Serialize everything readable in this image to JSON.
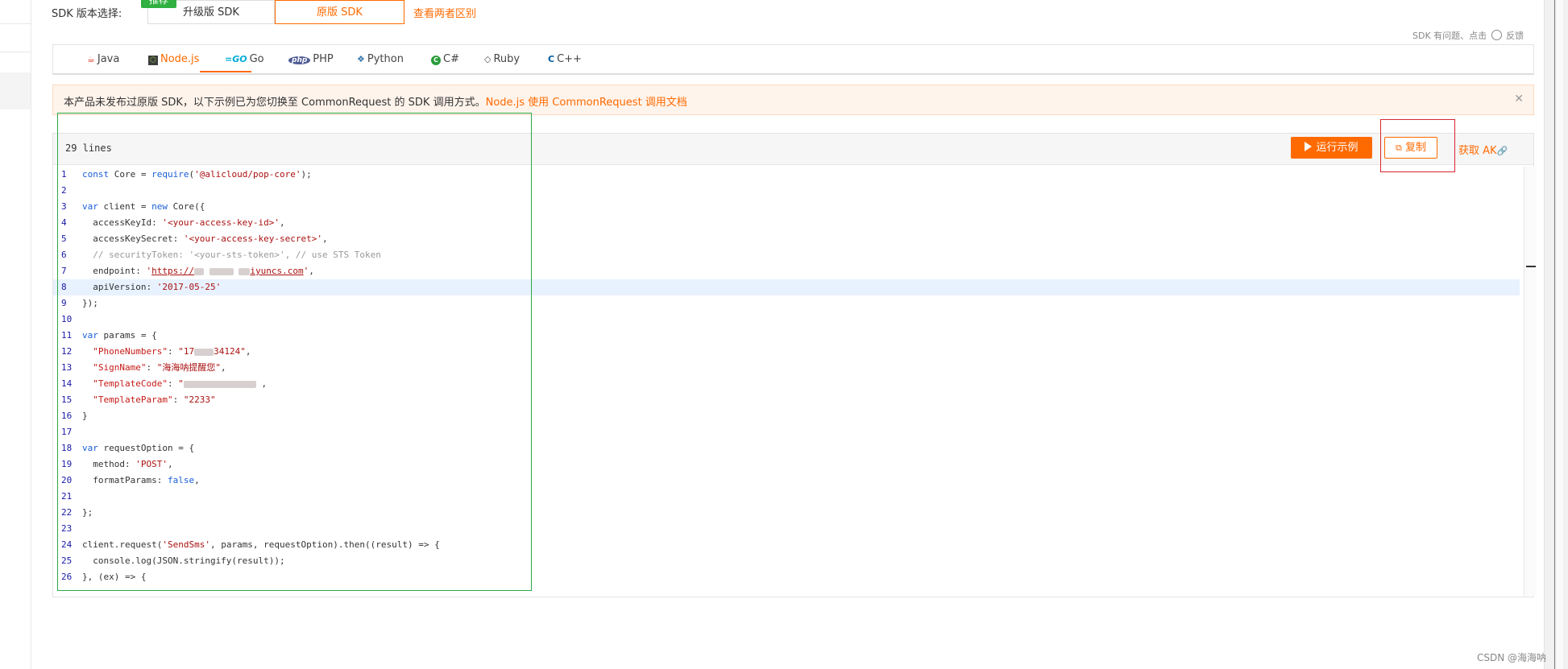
{
  "sdk_selector": {
    "label": "SDK 版本选择:",
    "badge": "推荐",
    "upgrade_label": "升级版 SDK",
    "original_label": "原版 SDK",
    "diff_link": "查看两者区别"
  },
  "feedback": {
    "prefix": "SDK 有问题、点击",
    "suffix": "反馈"
  },
  "tabs": [
    {
      "label": "Java",
      "icon": "java-icon"
    },
    {
      "label": "Node.js",
      "icon": "nodejs-icon",
      "active": true
    },
    {
      "label": "Go",
      "icon": "go-icon"
    },
    {
      "label": "PHP",
      "icon": "php-icon"
    },
    {
      "label": "Python",
      "icon": "python-icon"
    },
    {
      "label": "C#",
      "icon": "csharp-icon"
    },
    {
      "label": "Ruby",
      "icon": "ruby-icon"
    },
    {
      "label": "C++",
      "icon": "cpp-icon"
    }
  ],
  "notice": {
    "text": "本产品未发布过原版 SDK，以下示例已为您切换至 CommonRequest 的 SDK 调用方式。",
    "link": "Node.js 使用 CommonRequest 调用文档"
  },
  "code_panel": {
    "lines_count": "29 lines",
    "run_label": "运行示例",
    "copy_label": "复制",
    "ak_label": "获取 AK"
  },
  "code": {
    "l1_kw": "const",
    "l1_a": " Core = ",
    "l1_req": "require",
    "l1_b": "(",
    "l1_str": "'@alicloud/pop-core'",
    "l1_c": ");",
    "l3_kw": "var",
    "l3_a": " client = ",
    "l3_new": "new",
    "l3_b": " Core({",
    "l4_a": "  accessKeyId: ",
    "l4_str": "'<your-access-key-id>'",
    "l4_b": ",",
    "l5_a": "  accessKeySecret: ",
    "l5_str": "'<your-access-key-secret>'",
    "l5_b": ",",
    "l6_cmt": "  // securityToken: '<your-sts-token>', // use STS Token",
    "l7_a": "  endpoint: ",
    "l7_q1": "'",
    "l7_url_a": "https://",
    "l7_url_b": "iyuncs.com",
    "l7_q2": "'",
    "l7_b": ",",
    "l8_a": "  apiVersion: ",
    "l8_str": "'2017-05-25'",
    "l9": "});",
    "l11_kw": "var",
    "l11_a": " params = {",
    "l12_key": "  \"PhoneNumbers\"",
    "l12_a": ": ",
    "l12_s1": "\"17",
    "l12_s2": "34124\"",
    "l12_b": ",",
    "l13_key": "  \"SignName\"",
    "l13_a": ": ",
    "l13_str": "\"海海呐提醒您\"",
    "l13_b": ",",
    "l14_key": "  \"TemplateCode\"",
    "l14_a": ": ",
    "l14_s1": "\"",
    "l14_b": ",",
    "l15_key": "  \"TemplateParam\"",
    "l15_a": ": ",
    "l15_str": "\"2233\"",
    "l16": "}",
    "l18_kw": "var",
    "l18_a": " requestOption = {",
    "l19_a": "  method: ",
    "l19_str": "'POST'",
    "l19_b": ",",
    "l20_a": "  formatParams: ",
    "l20_kw": "false",
    "l20_b": ",",
    "l22": "};",
    "l24_a": "client.request(",
    "l24_str": "'SendSms'",
    "l24_b": ", params, requestOption).then((result) => {",
    "l25": "  console.log(JSON.stringify(result));",
    "l26": "}, (ex) => {"
  },
  "line_numbers": [
    "1",
    "2",
    "3",
    "4",
    "5",
    "6",
    "7",
    "8",
    "9",
    "10",
    "11",
    "12",
    "13",
    "14",
    "15",
    "16",
    "17",
    "18",
    "19",
    "20",
    "21",
    "22",
    "23",
    "24",
    "25",
    "26"
  ],
  "watermark": "CSDN @海海呐"
}
